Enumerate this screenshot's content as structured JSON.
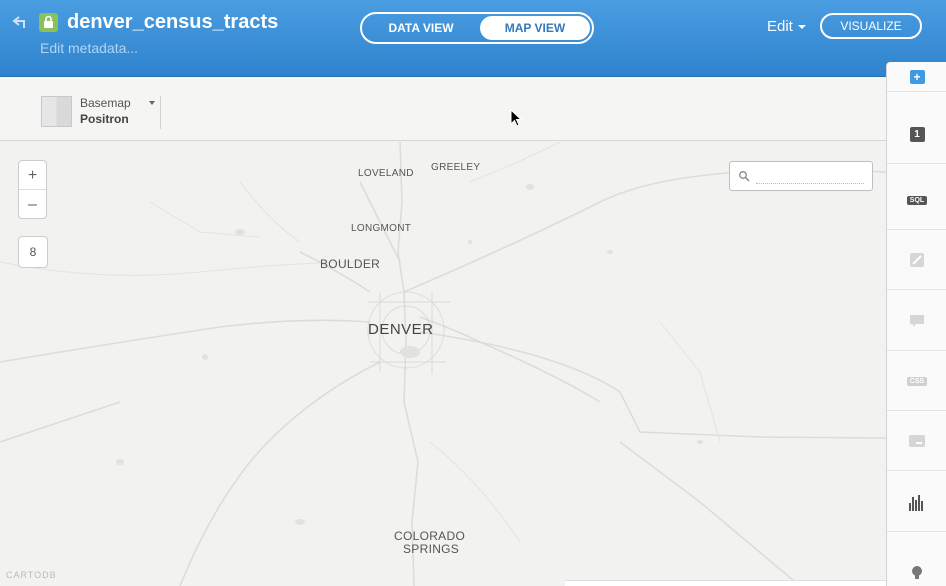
{
  "header": {
    "title": "denver_census_tracts",
    "subtitle": "Edit metadata...",
    "view_tabs": [
      {
        "label": "DATA VIEW",
        "active": false
      },
      {
        "label": "MAP VIEW",
        "active": true
      }
    ],
    "edit_label": "Edit",
    "visualize_label": "VISUALIZE"
  },
  "toolbar": {
    "basemap_label": "Basemap",
    "basemap_value": "Positron"
  },
  "map": {
    "zoom_in": "+",
    "zoom_out": "–",
    "zoom_level": "8",
    "search_placeholder": "",
    "cities": [
      "LOVELAND",
      "GREELEY",
      "LONGMONT",
      "BOULDER",
      "DENVER",
      "COLORADO",
      "SPRINGS"
    ],
    "attribution": "CARTODB"
  },
  "rightbar": {
    "layer_count": "1",
    "items": [
      {
        "icon": "add-layer-icon"
      },
      {
        "icon": "layer-number-icon"
      },
      {
        "icon": "sql-icon",
        "label": "SQL"
      },
      {
        "icon": "wizard-icon"
      },
      {
        "icon": "infowindow-icon"
      },
      {
        "icon": "css-icon",
        "label": "CSS"
      },
      {
        "icon": "legend-icon"
      },
      {
        "icon": "filter-icon"
      },
      {
        "icon": "layer-options-icon"
      }
    ]
  },
  "colors": {
    "header_blue": "#3a8bd6",
    "map_bg": "#f2f2f0",
    "accent_green": "#8cc05a"
  }
}
